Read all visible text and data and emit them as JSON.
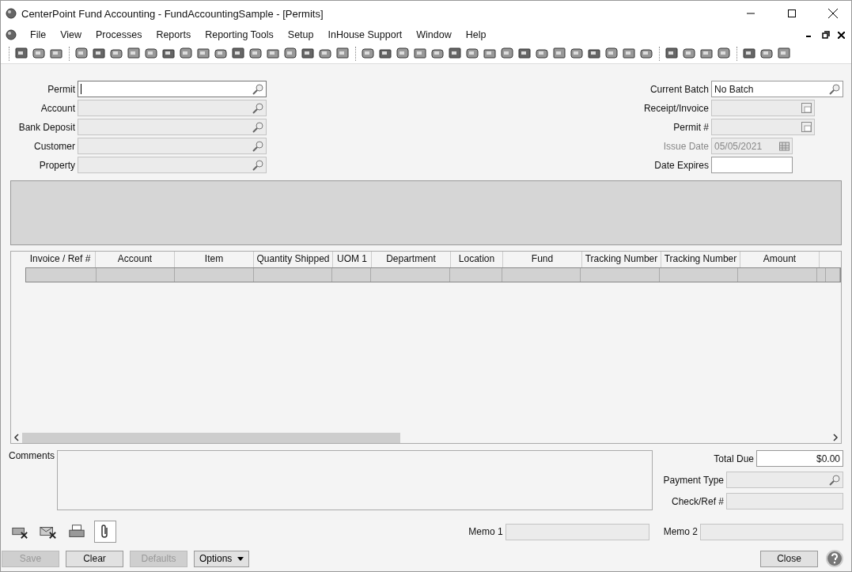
{
  "window": {
    "title": "CenterPoint Fund Accounting - FundAccountingSample - [Permits]"
  },
  "menu": [
    "File",
    "View",
    "Processes",
    "Reports",
    "Reporting Tools",
    "Setup",
    "InHouse Support",
    "Window",
    "Help"
  ],
  "left_fields": [
    {
      "label": "Permit",
      "kind": "search",
      "disabled": false,
      "focused": true
    },
    {
      "label": "Account",
      "kind": "search",
      "disabled": true,
      "focused": false
    },
    {
      "label": "Bank Deposit",
      "kind": "search",
      "disabled": true,
      "focused": false
    },
    {
      "label": "Customer",
      "kind": "search",
      "disabled": true,
      "focused": false
    },
    {
      "label": "Property",
      "kind": "search",
      "disabled": true,
      "focused": false
    }
  ],
  "right_fields": [
    {
      "label": "Current Batch",
      "kind": "search",
      "value": "No Batch",
      "disabled": false
    },
    {
      "label": "Receipt/Invoice",
      "kind": "number",
      "disabled": true
    },
    {
      "label": "Permit #",
      "kind": "number",
      "disabled": true
    },
    {
      "label": "Issue Date",
      "kind": "date",
      "value": "05/05/2021",
      "disabled": true
    },
    {
      "label": "Date Expires",
      "kind": "plain",
      "disabled": false
    }
  ],
  "grid": {
    "columns": [
      "Invoice / Ref #",
      "Account",
      "Item",
      "Quantity Shipped",
      "UOM 1",
      "Department",
      "Location",
      "Fund",
      "Tracking Number",
      "Tracking Number",
      "Amount"
    ]
  },
  "comments": {
    "label": "Comments"
  },
  "totals": [
    {
      "label": "Total Due",
      "kind": "amount",
      "value": "$0.00"
    },
    {
      "label": "Payment Type",
      "kind": "search"
    },
    {
      "label": "Check/Ref #",
      "kind": "plain"
    }
  ],
  "memos": [
    {
      "label": "Memo 1"
    },
    {
      "label": "Memo 2"
    }
  ],
  "buttons": [
    {
      "label": "Save",
      "disabled": true
    },
    {
      "label": "Clear",
      "disabled": false
    },
    {
      "label": "Defaults",
      "disabled": true
    }
  ],
  "options_button": {
    "label": "Options"
  },
  "close_button": {
    "label": "Close"
  }
}
